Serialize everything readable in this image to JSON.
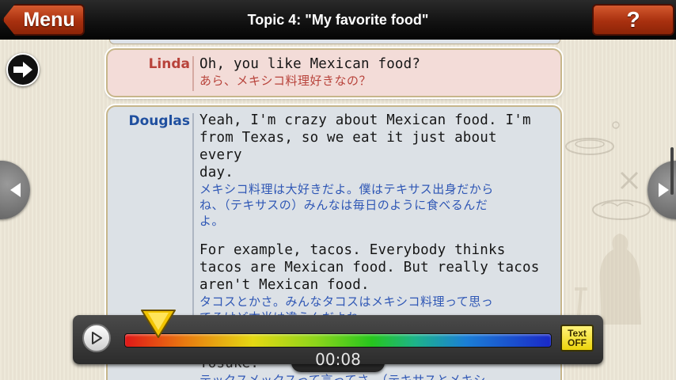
{
  "header": {
    "menu_label": "Menu",
    "title": "Topic 4: \"My favorite food\"",
    "help_label": "?"
  },
  "dialogue": {
    "linda": {
      "speaker": "Linda",
      "en": "Oh, you like Mexican food?",
      "jp": "あら、メキシコ料理好きなの？"
    },
    "douglas": {
      "speaker": "Douglas",
      "p1_en_lines": [
        "Yeah, I'm crazy about Mexican food. I'm",
        "from Texas, so we eat it just about every",
        "day."
      ],
      "p1_jp_lines": [
        "メキシコ料理は大好きだよ。僕はテキサス出身だから",
        "ね、（テキサスの）みんなは毎日のように食べるんだ",
        "よ。"
      ],
      "p2_en_lines": [
        "For example, tacos. Everybody thinks",
        "tacos are Mexican food. But really tacos",
        "aren't Mexican food."
      ],
      "p2_jp_lines": [
        "タコスとかさ。みんなタコスはメキシコ料理って思っ",
        "てるけど本当は違うんだよね。"
      ]
    },
    "next_speaker_fragment": "Yosuke:",
    "next_jp_fragment": "テックスメックスって言ってさ、（テキサスとメキシ"
  },
  "player": {
    "time": "00:08",
    "progress_fraction": 0.08,
    "text_toggle_line1": "Text",
    "text_toggle_line2": "OFF"
  },
  "colors": {
    "accent_red": "#a8300f",
    "linda_name": "#b8433b",
    "douglas_name": "#1f4f9f"
  },
  "icons": {
    "next": "arrow-right-icon",
    "prev_page": "chevron-left-icon",
    "next_page": "chevron-right-icon",
    "play": "play-icon"
  }
}
